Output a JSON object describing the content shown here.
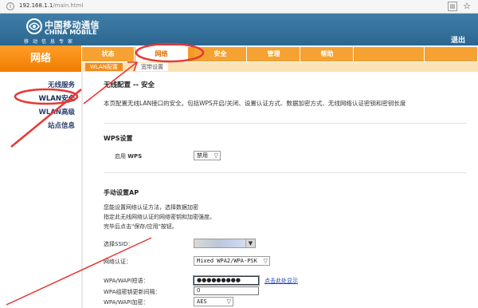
{
  "browser": {
    "url_host": "192.168.1.1",
    "url_path": "/main.html",
    "info_icon": "info-icon",
    "reader_icon": "reader-mode-icon",
    "bookmark_icon": "star-icon"
  },
  "header": {
    "brand_cn": "中国移动通信",
    "brand_en": "CHINA MOBILE",
    "slogan": "移动信息专家",
    "logout_label": "退出"
  },
  "section_title": "网络",
  "tabs": [
    {
      "label": "状态",
      "active": false
    },
    {
      "label": "网络",
      "active": true
    },
    {
      "label": "安全",
      "active": false
    },
    {
      "label": "管理",
      "active": false
    },
    {
      "label": "帮助",
      "active": false
    }
  ],
  "subtabs": [
    {
      "label": "WLAN配置",
      "active": true
    },
    {
      "label": "宽带设置",
      "active": false
    }
  ],
  "sidebar": {
    "items": [
      {
        "label": "无线服务",
        "selected": false
      },
      {
        "label": "WLAN安全",
        "selected": true
      },
      {
        "label": "WLAN高级",
        "selected": false
      },
      {
        "label": "站点信息",
        "selected": false
      }
    ]
  },
  "main": {
    "title": "无线配置 -- 安全",
    "description": "本页配置无线LAN接口的安全。包括WPS开启/关闭、设置认证方式、数据加密方式、无线网络认证密钥和密钥长度",
    "wps": {
      "heading": "WPS设置",
      "enable_label_prefix": "启用 ",
      "enable_label_bold": "WPS",
      "enable_value": "禁用"
    },
    "manual_ap": {
      "heading": "手动设置AP",
      "instructions": [
        "您能设置网络认证方法，选择数据加密",
        "指定此无线网络认证的网络密钥和加密强度。",
        "完毕后点击\"保存/应用\"按钮。"
      ],
      "ssid_label": "选择SSID：",
      "auth_label": "网络认证：",
      "auth_value": "Mixed WPA2/WPA-PSK",
      "psk_label": "WPA/WAPI短语：",
      "psk_value": "●●●●●●●●●",
      "show_link": "点击此处显示",
      "rekey_label": "WPA组密钥更新间隔：",
      "rekey_value": "0",
      "encrypt_label": "WPA/WAPI加密：",
      "encrypt_value": "AES"
    }
  },
  "annotation_color": "#e53935"
}
